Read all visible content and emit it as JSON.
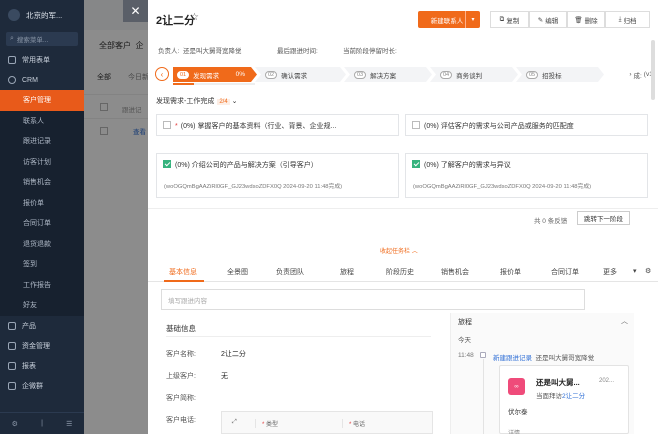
{
  "sidebar": {
    "org_name": "北京的军...",
    "search_placeholder": "搜索菜单...",
    "items": [
      {
        "label": "常用表单",
        "icon": "form-icon"
      },
      {
        "label": "CRM",
        "icon": "crm-icon"
      }
    ],
    "crm_subitems": [
      "客户管理",
      "联系人",
      "跟进记录",
      "访客计划",
      "销售机会",
      "报价单",
      "合同订单",
      "退货退款",
      "签到",
      "工作报告",
      "好友"
    ],
    "active_subitem": "客户管理",
    "bottom_items": [
      {
        "label": "产品",
        "icon": "product-icon"
      },
      {
        "label": "资金管理",
        "icon": "fund-icon"
      },
      {
        "label": "报表",
        "icon": "report-icon"
      },
      {
        "label": "企微群",
        "icon": "group-icon"
      }
    ]
  },
  "background": {
    "tab_all_customers": "全部客户",
    "tab_other": "企",
    "sub_tab_all": "全部",
    "sub_tab_today": "今日新",
    "row1_cell": "跟进记",
    "row2_link": "查看"
  },
  "drawer": {
    "title": "2让二分",
    "buttons": {
      "primary": "新建联系人",
      "copy": "复制",
      "edit": "编辑",
      "delete": "删除",
      "archive": "归档"
    },
    "meta": {
      "owner_label": "负责人:",
      "owner_value": "还是叫大舅哥宽降觉",
      "last_followup_label": "最后跟进时间:",
      "last_followup_value": "",
      "stay_label": "当前阶段停留时长:",
      "stay_value": ""
    },
    "stages": [
      {
        "num": "01",
        "label": "发现需求",
        "pct": "0%",
        "active": true
      },
      {
        "num": "02",
        "label": "确认需求"
      },
      {
        "num": "03",
        "label": "解决方案"
      },
      {
        "num": "04",
        "label": "商务谈判"
      },
      {
        "num": "05",
        "label": "招投标"
      }
    ],
    "stage_progress": 0.25,
    "stage_end_label": "成:",
    "stage_version": "(v1)",
    "task_section": {
      "title": "发现需求-工作完成",
      "badge": "2/4",
      "tasks": [
        {
          "checked": false,
          "required": true,
          "text": "(0%)  掌握客户的基本资料（行业、背景、企业规...",
          "sub": ""
        },
        {
          "checked": false,
          "required": false,
          "text": "(0%)  评估客户的需求与公司产品或服务的匹配度",
          "sub": ""
        },
        {
          "checked": true,
          "required": false,
          "text": "(0%)  介绍公司的产品与解决方案（引导客户）",
          "sub": "(woOGQmBgAAZiRl0GF_GJ23wdsoZDFX0Q 2024-09-20 11:48完成)"
        },
        {
          "checked": true,
          "required": false,
          "text": "(0%)  了解客户的需求与异议",
          "sub": "(woOGQmBgAAZiRl0GF_GJ23wdsoZDFX0Q 2024-09-20 11:48完成)"
        }
      ],
      "feedback": "共 0 条反馈",
      "next_stage_button": "跳转下一阶段",
      "collapse_label": "收起任务栏"
    },
    "tabs": [
      "基本信息",
      "全景图",
      "负责团队",
      "旅程",
      "阶段历史",
      "销售机会",
      "报价单",
      "合同订单",
      "更多"
    ],
    "active_tab": "基本信息",
    "note_placeholder": "填写跟进内容",
    "form": {
      "section_title": "基础信息",
      "fields": [
        {
          "label": "客户名称:",
          "value": "2让二分"
        },
        {
          "label": "上级客户:",
          "value": "无"
        },
        {
          "label": "客户简称:",
          "value": ""
        },
        {
          "label": "客户电话:",
          "value": ""
        }
      ],
      "phone_columns": [
        "类型",
        "电话"
      ]
    },
    "timeline": {
      "title": "旅程",
      "today": "今天",
      "time": "11:48",
      "event": "新建跟进记录",
      "event_actor": "还是叫大舅哥宽降觉",
      "card_name": "还是叫大舅...",
      "card_date": "202...",
      "card_relation_prefix": "当面拜访",
      "card_relation_target": "2让二分",
      "card_body": "伏尔泰",
      "card_footer": "详情"
    }
  }
}
